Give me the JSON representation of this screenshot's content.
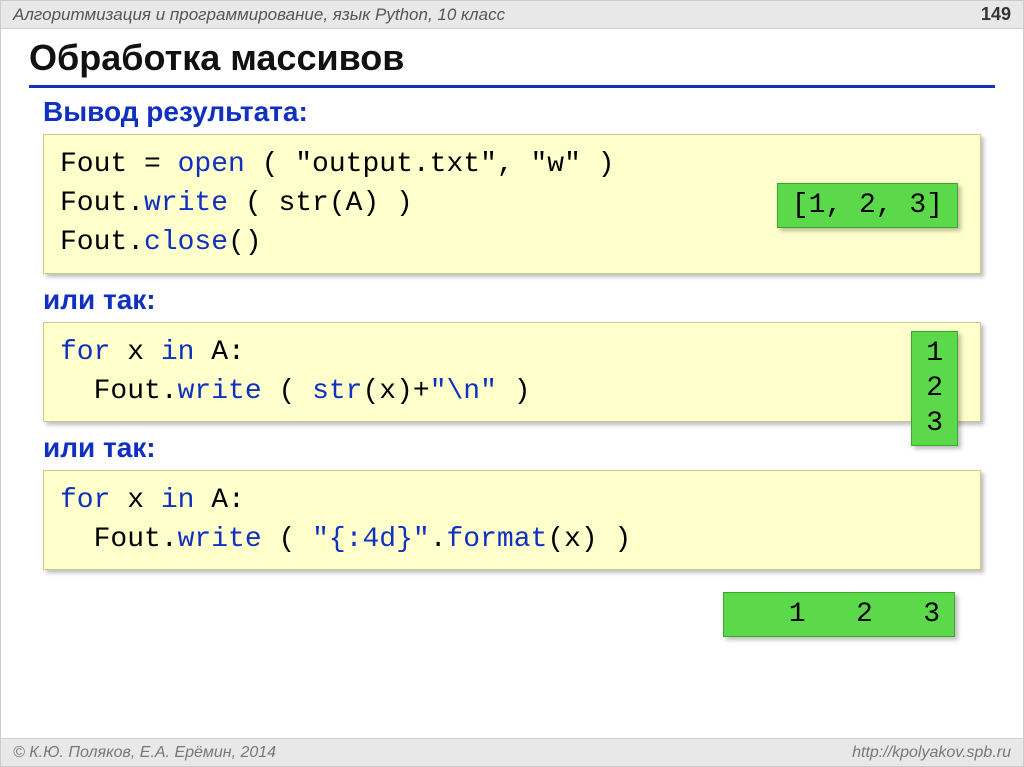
{
  "header": {
    "title": "Алгоритмизация и программирование, язык Python, 10 класс",
    "page": "149"
  },
  "main_title": "Обработка массивов",
  "subtitle": "Вывод результата:",
  "code1": {
    "l1_a": "Fout = ",
    "l1_b": "open",
    "l1_c": " ( \"output.txt\", \"w\" )",
    "l2_a": "Fout.",
    "l2_b": "write",
    "l2_c": " ( str(A) )",
    "l3_a": "Fout.",
    "l3_b": "close",
    "l3_c": "()"
  },
  "out1": "[1, 2, 3]",
  "alt1": "или так:",
  "code2": {
    "l1_a": "for",
    "l1_b": " x ",
    "l1_c": "in",
    "l1_d": " A:",
    "l2_a": "  Fout.",
    "l2_b": "write",
    "l2_c": " ( ",
    "l2_d": "str",
    "l2_e": "(x)+",
    "l2_f": "\"\\n\"",
    "l2_g": " )"
  },
  "out2": "1\n2\n3",
  "alt2": "или так:",
  "code3": {
    "l1_a": "for",
    "l1_b": " x ",
    "l1_c": "in",
    "l1_d": " A:",
    "l2_a": "  Fout.",
    "l2_b": "write",
    "l2_c": " ( ",
    "l2_d": "\"{:4d}\"",
    "l2_e": ".",
    "l2_f": "format",
    "l2_g": "(x) )"
  },
  "out3": "   1   2   3",
  "footer": {
    "left": "© К.Ю. Поляков, Е.А. Ерёмин, 2014",
    "right": "http://kpolyakov.spb.ru"
  }
}
